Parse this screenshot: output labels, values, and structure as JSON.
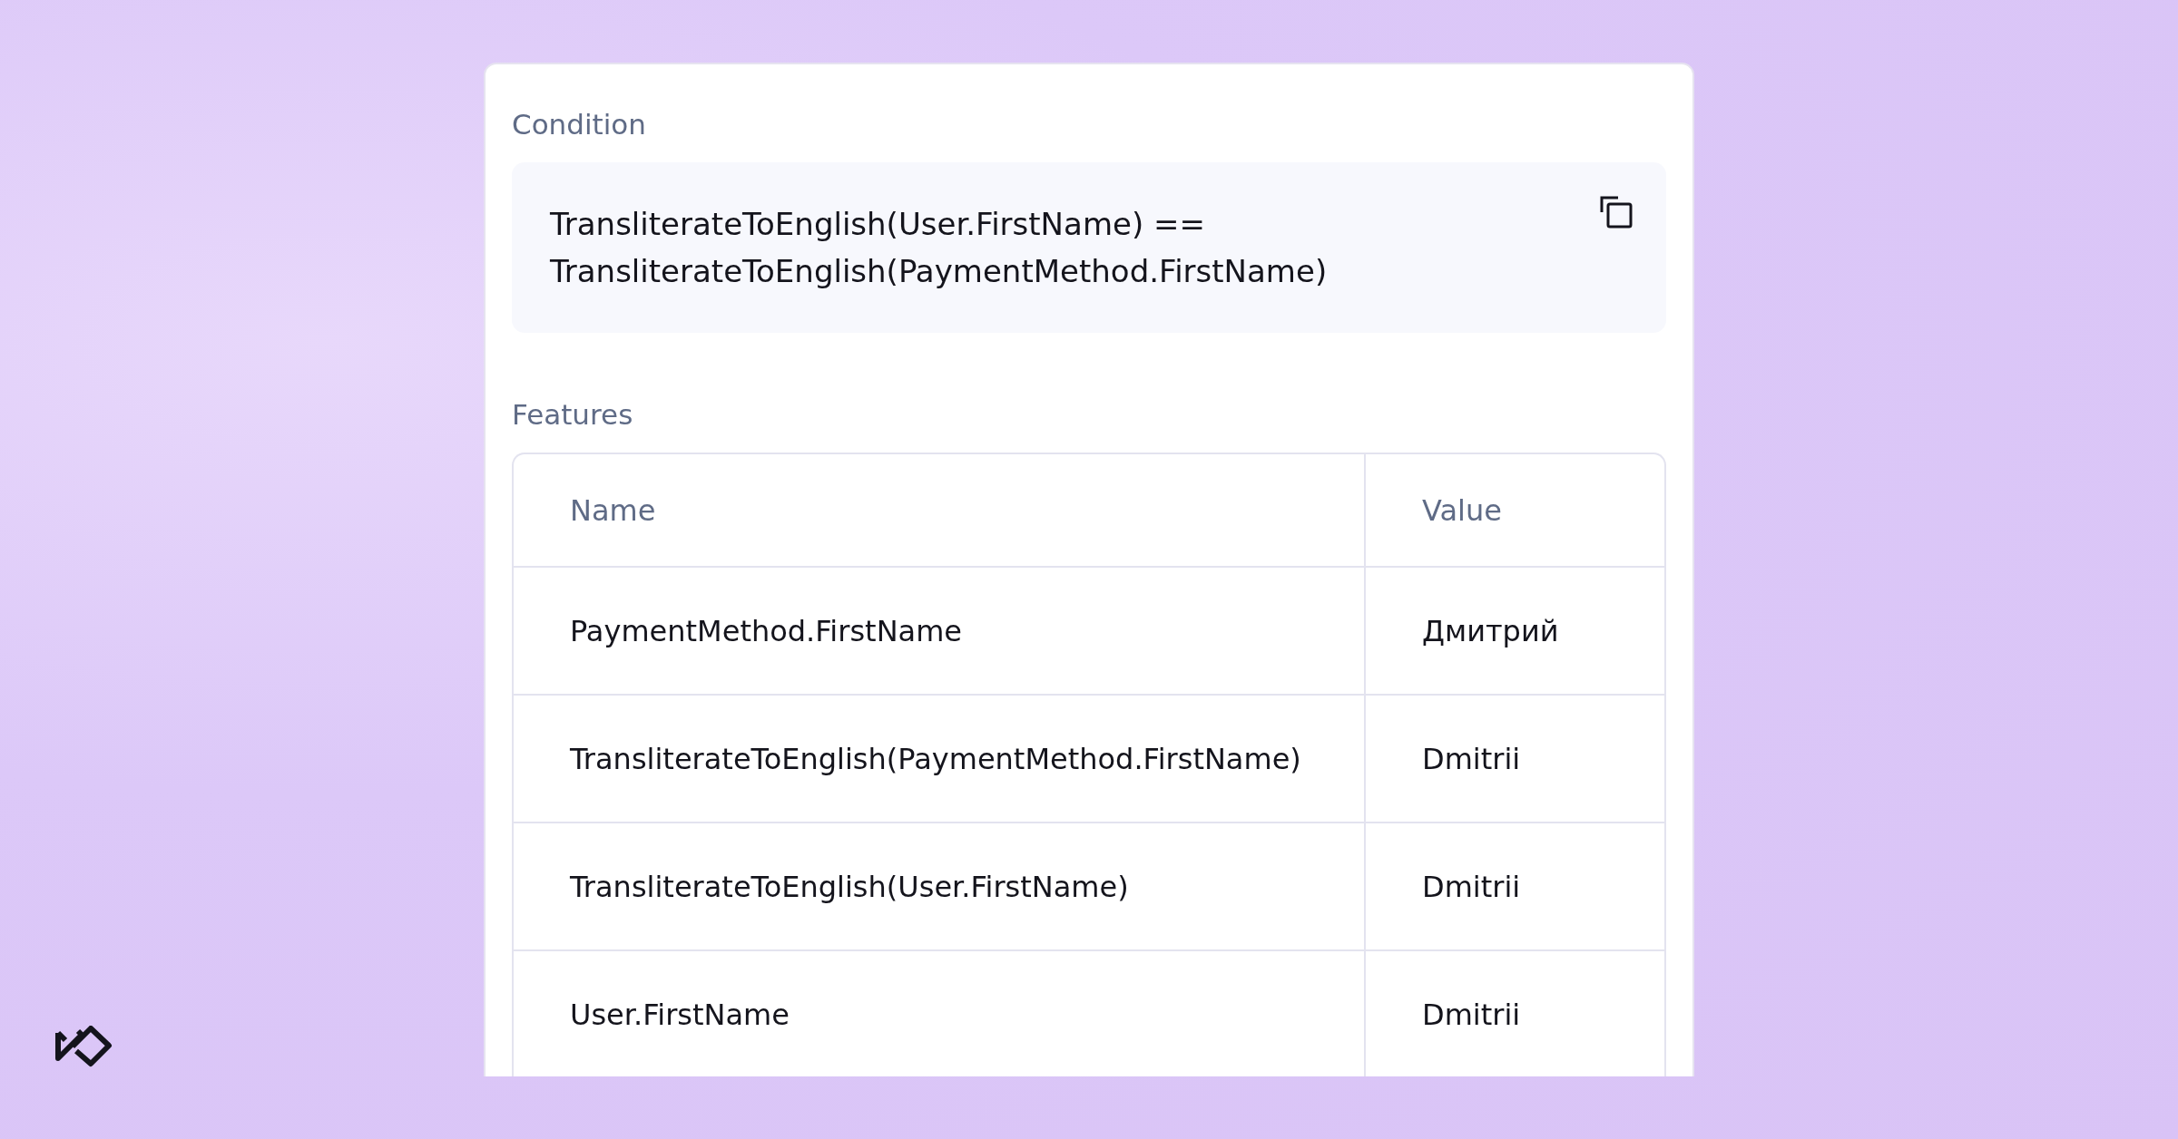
{
  "condition": {
    "label": "Condition",
    "code_lines": [
      "TransliterateToEnglish(User.FirstName) ==",
      "TransliterateToEnglish(PaymentMethod.FirstName)"
    ]
  },
  "features": {
    "label": "Features",
    "columns": [
      "Name",
      "Value"
    ],
    "rows": [
      [
        "PaymentMethod.FirstName",
        "Дмитрий"
      ],
      [
        "TransliterateToEnglish(PaymentMethod.FirstName)",
        "Dmitrii"
      ],
      [
        "TransliterateToEnglish(User.FirstName)",
        "Dmitrii"
      ],
      [
        "User.FirstName",
        "Dmitrii"
      ]
    ]
  }
}
